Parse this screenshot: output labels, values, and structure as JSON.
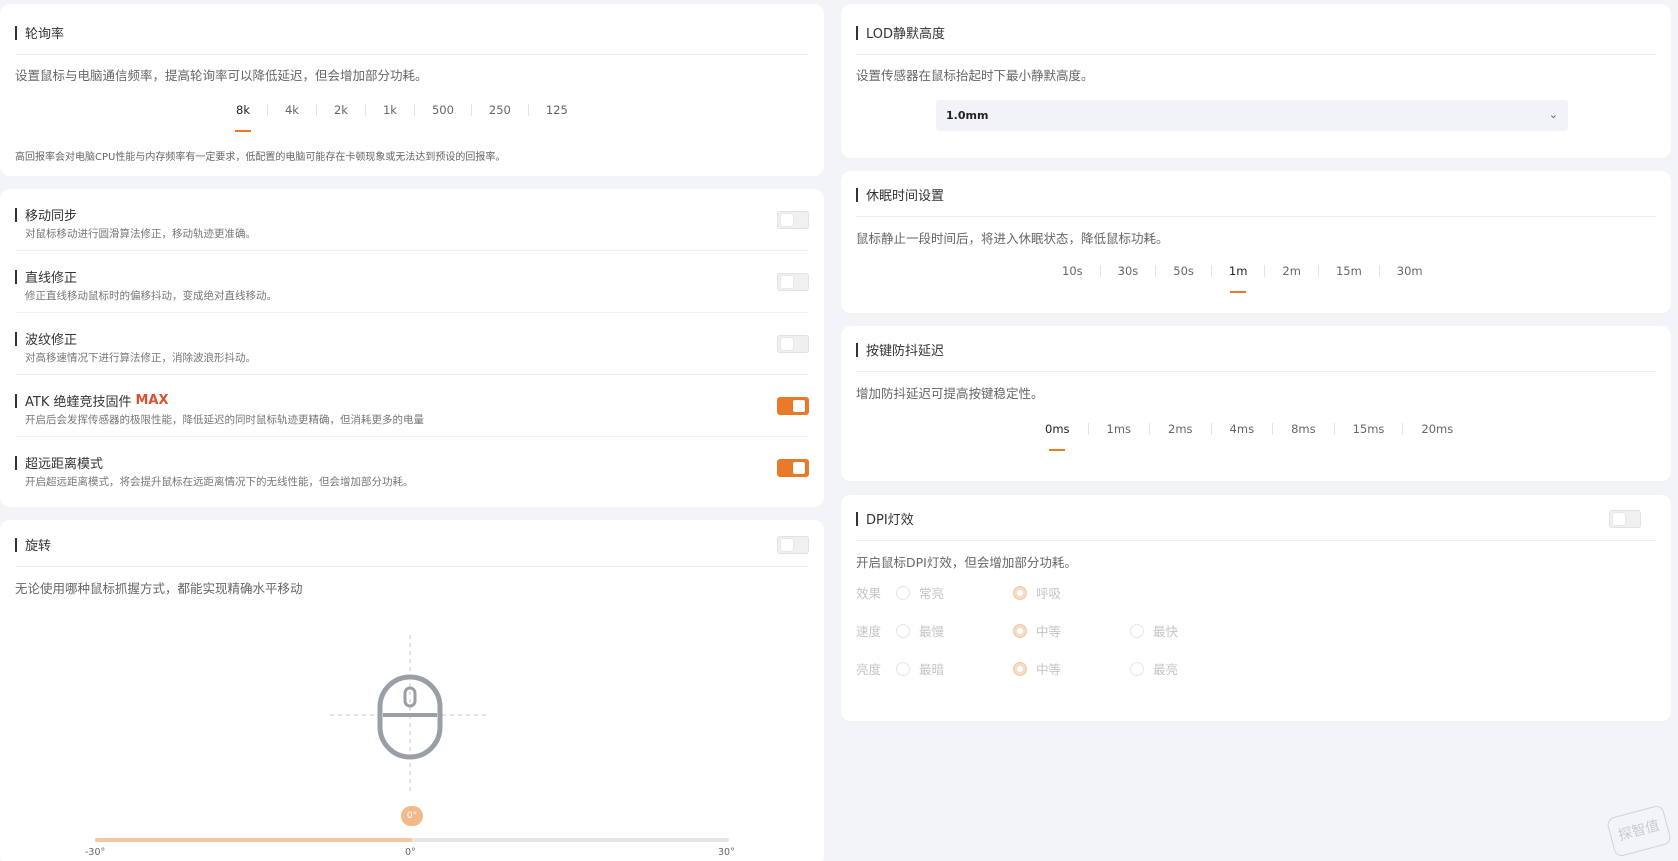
{
  "polling": {
    "title": "轮询率",
    "desc": "设置鼠标与电脑通信频率，提高轮询率可以降低延迟，但会增加部分功耗。",
    "options": [
      "8k",
      "4k",
      "2k",
      "1k",
      "500",
      "250",
      "125"
    ],
    "selected": "8k",
    "note": "高回报率会对电脑CPU性能与内存频率有一定要求，低配置的电脑可能存在卡顿现象或无法达到预设的回报率。"
  },
  "features": [
    {
      "title": "移动同步",
      "desc": "对鼠标移动进行圆滑算法修正，移动轨迹更准确。",
      "on": false
    },
    {
      "title": "直线修正",
      "desc": "修正直线移动鼠标时的偏移抖动，变成绝对直线移动。",
      "on": false
    },
    {
      "title": "波纹修正",
      "desc": "对高移速情况下进行算法修正，消除波浪形抖动。",
      "on": false
    },
    {
      "title": "ATK 绝蝰竞技固件",
      "badge": "MAX",
      "desc": "开启后会发挥传感器的极限性能，降低延迟的同时鼠标轨迹更精确，但消耗更多的电量",
      "on": true
    },
    {
      "title": "超远距离模式",
      "desc": "开启超远距离模式，将会提升鼠标在远距离情况下的无线性能，但会增加部分功耗。",
      "on": true
    }
  ],
  "rotation": {
    "title": "旋转",
    "desc": "无论使用哪种鼠标抓握方式，都能实现精确水平移动",
    "enabled": false,
    "icon": "mouse-icon",
    "value_label": "0°",
    "value": 0,
    "min": -30,
    "max": 30,
    "min_label": "-30°",
    "mid_label": "0°",
    "max_label": "30°"
  },
  "lod": {
    "title": "LOD静默高度",
    "desc": "设置传感器在鼠标抬起时下最小静默高度。",
    "selected": "1.0mm"
  },
  "sleep": {
    "title": "休眠时间设置",
    "desc": "鼠标静止一段时间后，将进入休眠状态，降低鼠标功耗。",
    "options": [
      "10s",
      "30s",
      "50s",
      "1m",
      "2m",
      "15m",
      "30m"
    ],
    "selected": "1m"
  },
  "debounce": {
    "title": "按键防抖延迟",
    "desc": "增加防抖延迟可提高按键稳定性。",
    "options": [
      "0ms",
      "1ms",
      "2ms",
      "4ms",
      "8ms",
      "15ms",
      "20ms"
    ],
    "selected": "0ms"
  },
  "dpi_light": {
    "title": "DPI灯效",
    "desc": "开启鼠标DPI灯效，但会增加部分功耗。",
    "enabled": false,
    "rows": [
      {
        "label": "效果",
        "options": [
          {
            "label": "常亮",
            "checked": false
          },
          {
            "label": "呼吸",
            "checked": true
          }
        ]
      },
      {
        "label": "速度",
        "options": [
          {
            "label": "最慢",
            "checked": false
          },
          {
            "label": "中等",
            "checked": true
          },
          {
            "label": "最快",
            "checked": false
          }
        ]
      },
      {
        "label": "亮度",
        "options": [
          {
            "label": "最暗",
            "checked": false
          },
          {
            "label": "中等",
            "checked": true
          },
          {
            "label": "最亮",
            "checked": false
          }
        ]
      }
    ]
  },
  "watermark": "探智值",
  "colors": {
    "accent": "#e87a2a",
    "background": "#f2f4f7",
    "card": "#ffffff"
  }
}
